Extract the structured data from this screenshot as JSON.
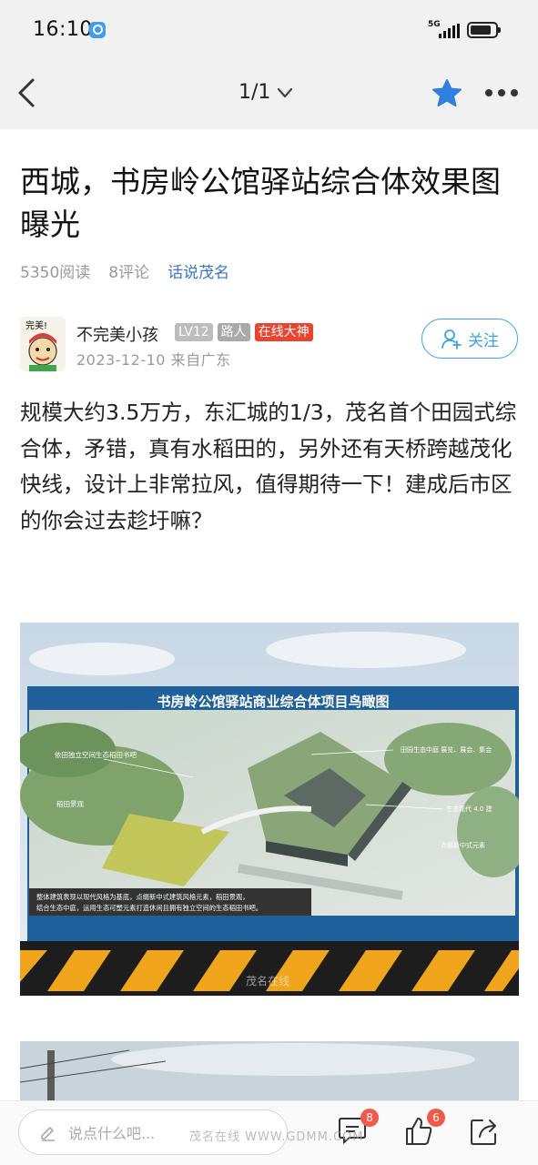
{
  "status": {
    "time": "16:10",
    "network": "5G"
  },
  "header": {
    "page_indicator": "1/1"
  },
  "post": {
    "title": "西城，书房岭公馆驿站综合体效果图曝光",
    "reads": "5350阅读",
    "comments": "8评论",
    "topic": "话说茂名",
    "author": {
      "name": "不完美小孩",
      "level": "LV12",
      "role": "路人",
      "honor": "在线大神",
      "date_location": "2023-12-10  来自广东",
      "avatar_text": "完美!"
    },
    "follow_label": "关注",
    "body": "规模大约3.5万方，东汇城的1/3，茂名首个田园式综合体，矛错，真有水稻田的，另外还有天桥跨越茂化快线，设计上非常拉风，值得期待一下！建成后市区的你会过去趁圩嘛？",
    "image1": {
      "banner_title": "书房岭公馆驿站商业综合体项目鸟瞰图",
      "labels": [
        "依田独立空间生态稻田书吧",
        "稻田景观",
        "田园生态中庭 展览、展会、集会",
        "生态现代 4.0 建",
        "点缀新中式元素"
      ],
      "caption_line1": "整体建筑表现以现代风格为基底，点缀新中式建筑风格元素，稻田景观，",
      "caption_line2": "结合生态中庭，运用生态可塑元素打造休闲且拥有独立空间的生态稻田书吧。",
      "watermark": "茂名在线"
    }
  },
  "bottom_bar": {
    "comment_placeholder": "说点什么吧...",
    "comment_count": "8",
    "like_count": "6",
    "watermark": "茂名在线 WWW.GDMM.COM"
  },
  "colors": {
    "accent_blue": "#2f7fe0",
    "follow_blue": "#3aa6dd",
    "badge_red": "#e8442f"
  }
}
